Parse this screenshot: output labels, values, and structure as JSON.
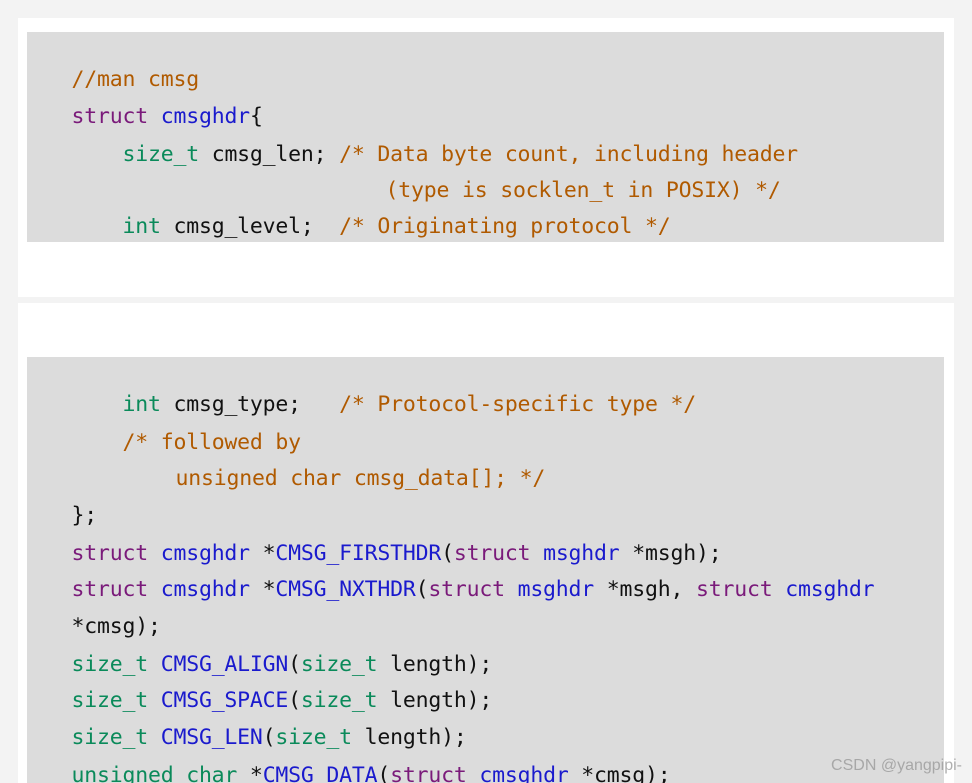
{
  "lines": {
    "l1": {
      "comment": "//man cmsg"
    },
    "l2": {
      "kw": "struct",
      "name": "cmsghdr",
      "rest": "{"
    },
    "l3": {
      "indent": "    ",
      "type": "size_t",
      "rest": " cmsg_len; ",
      "comment": "/* Data byte count, including header"
    },
    "l4": {
      "comment": "(type is socklen_t in POSIX) */"
    },
    "l5": {
      "indent": "    ",
      "type": "int",
      "rest": " cmsg_level;  ",
      "comment": "/* Originating protocol */"
    },
    "l6": {
      "indent": "    ",
      "type": "int",
      "rest": " cmsg_type;   ",
      "comment": "/* Protocol-specific type */"
    },
    "l7": {
      "indent": "    ",
      "comment": "/* followed by"
    },
    "l8": {
      "comment": "unsigned char cmsg_data[]; */"
    },
    "l9": {
      "rest": "};"
    },
    "l10": {
      "kw1": "struct",
      "name1": " cmsghdr",
      "star1": " *",
      "func": "CMSG_FIRSTHDR",
      "paren": "(",
      "kw2": "struct",
      "name2": " msghdr",
      "tail": " *msgh);"
    },
    "l11": {
      "kw1": "struct",
      "name1": " cmsghdr",
      "star1": " *",
      "func": "CMSG_NXTHDR",
      "paren": "(",
      "kw2": "struct",
      "name2": " msghdr",
      "mid": " *msgh, ",
      "kw3": "struct",
      "name3": " cmsghdr"
    },
    "l12": {
      "rest": "*cmsg);"
    },
    "l13": {
      "type1": "size_t",
      "func": " CMSG_ALIGN",
      "paren": "(",
      "type2": "size_t",
      "tail": " length);"
    },
    "l14": {
      "type1": "size_t",
      "func": " CMSG_SPACE",
      "paren": "(",
      "type2": "size_t",
      "tail": " length);"
    },
    "l15": {
      "type1": "size_t",
      "func": " CMSG_LEN",
      "paren": "(",
      "type2": "size_t",
      "tail": " length);"
    },
    "l16": {
      "type1": "unsigned char",
      "star": " *",
      "func": "CMSG_DATA",
      "paren": "(",
      "kw": "struct",
      "name": " cmsghdr",
      "tail": " *cmsg);"
    }
  },
  "watermark": "CSDN @yangpipi-"
}
